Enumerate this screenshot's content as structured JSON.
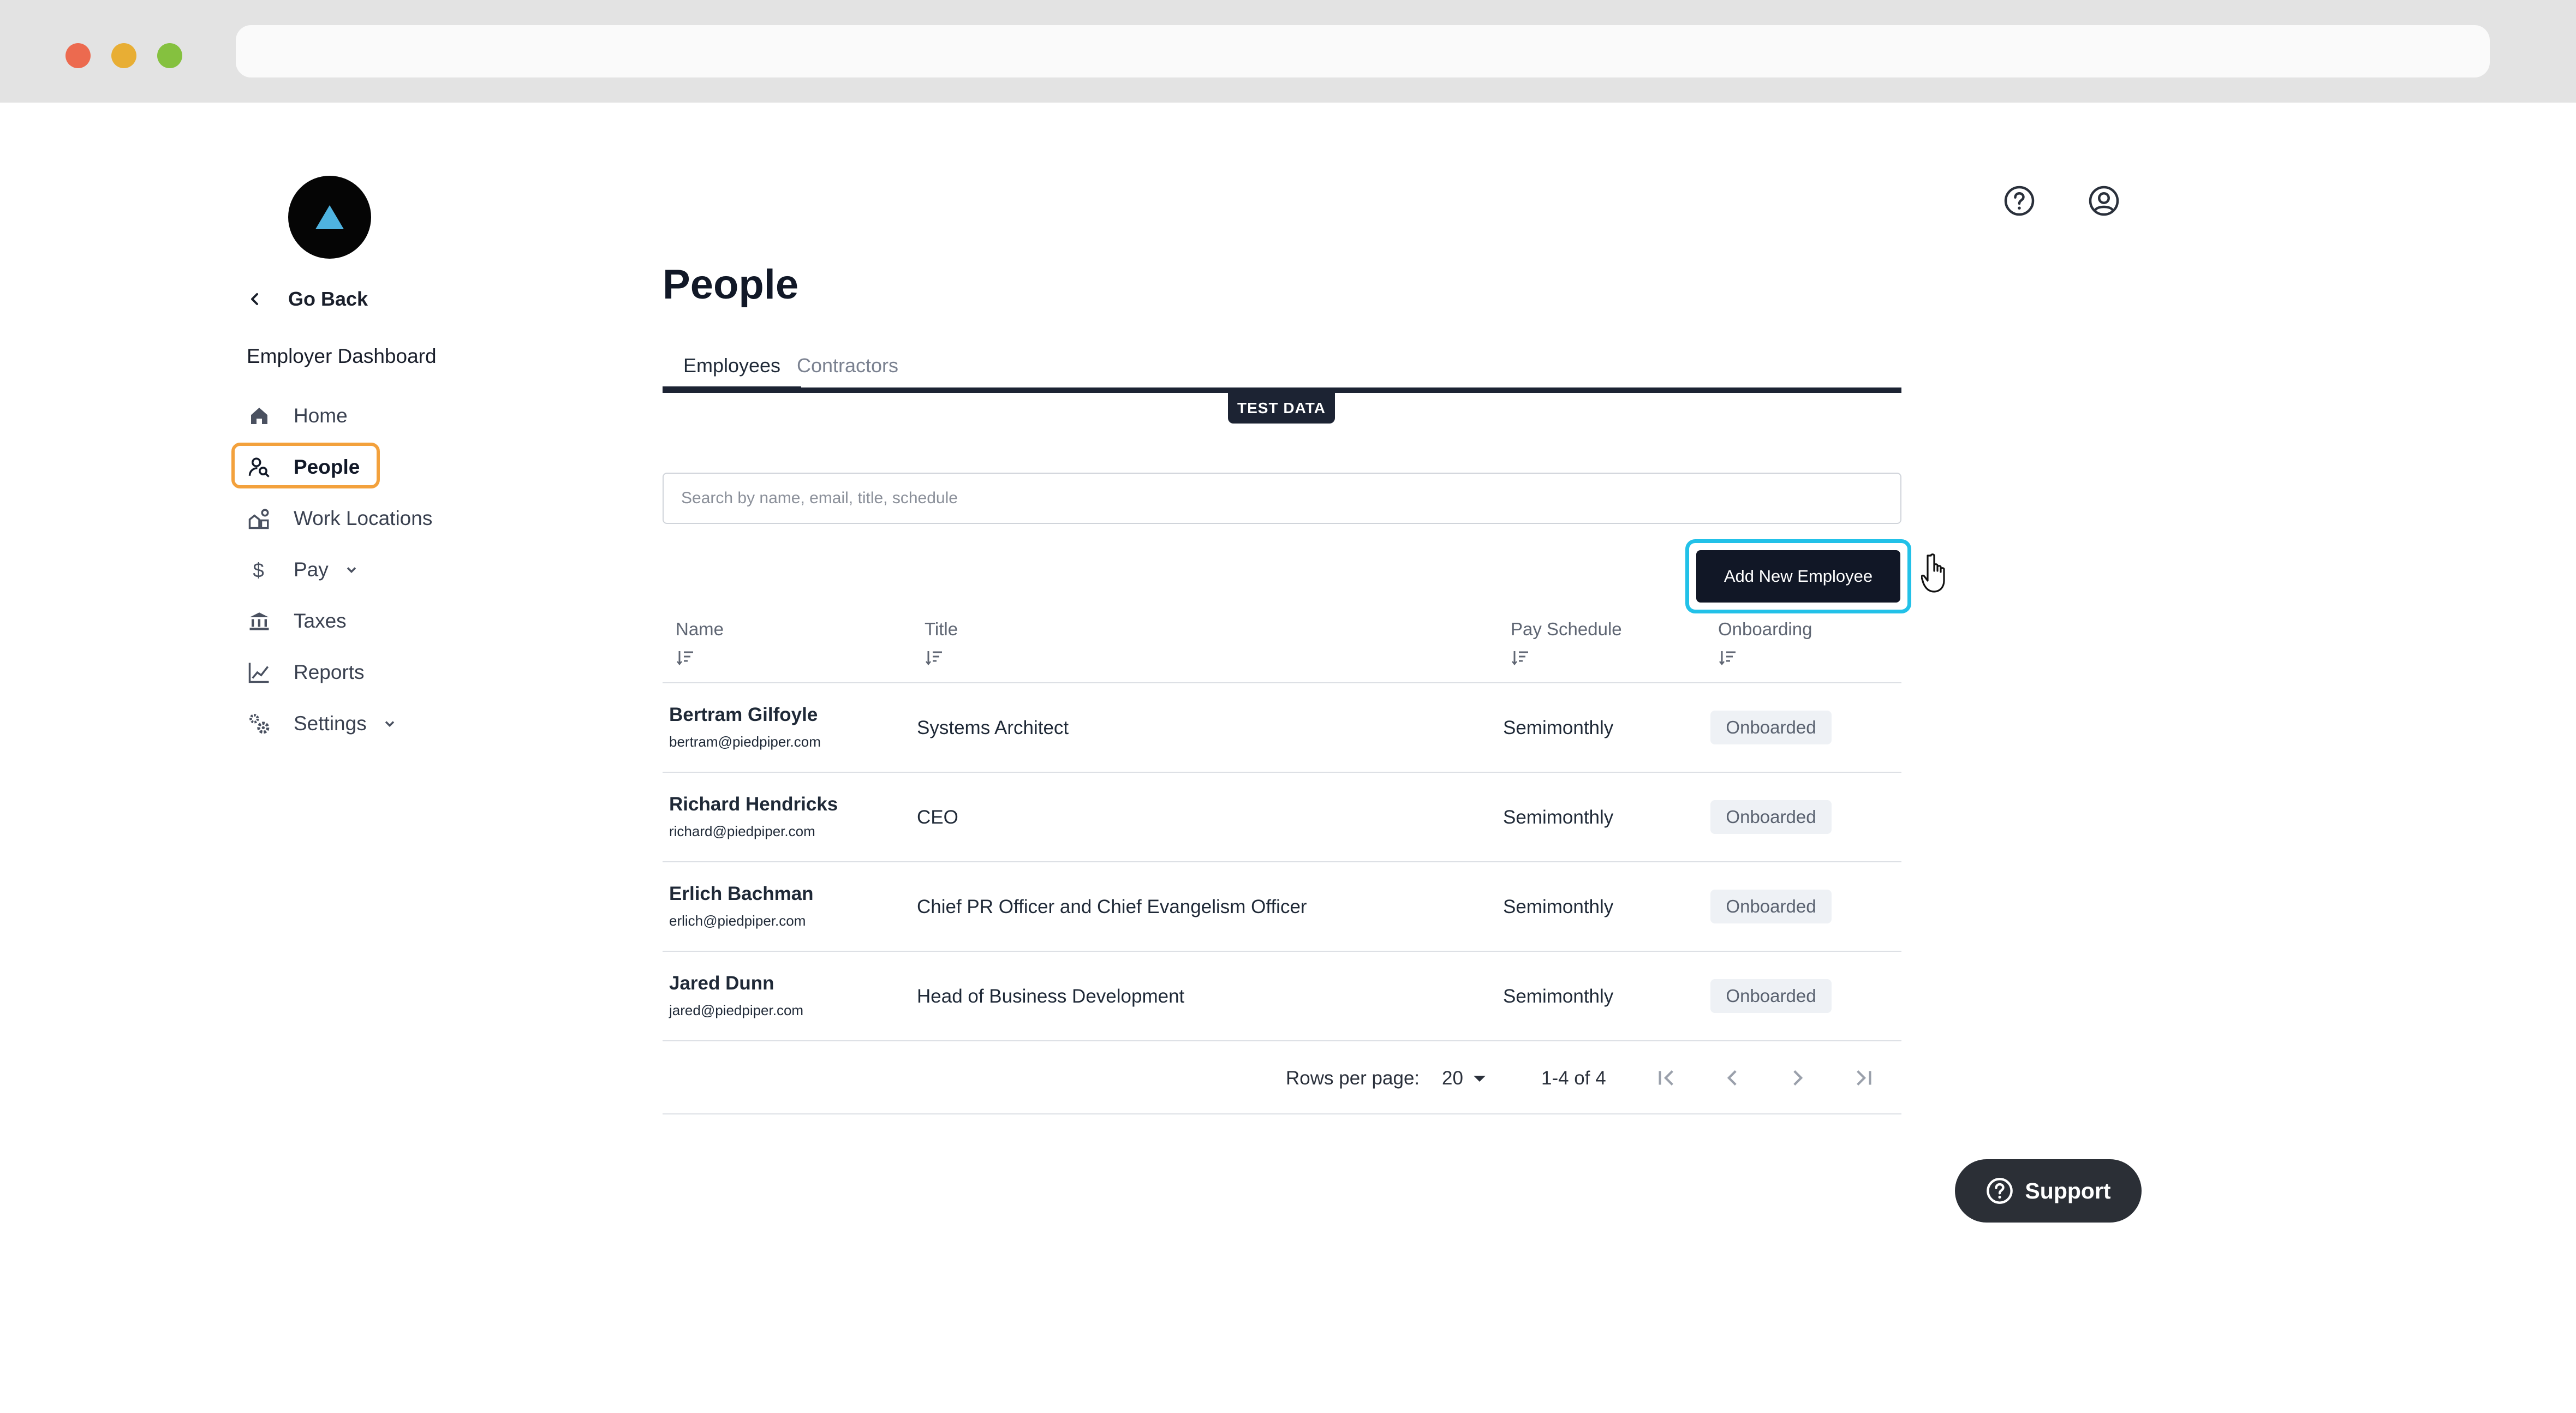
{
  "browser": {
    "url": ""
  },
  "sidebar": {
    "go_back": "Go Back",
    "section_title": "Employer Dashboard",
    "items": [
      {
        "label": "Home",
        "icon": "home-icon"
      },
      {
        "label": "People",
        "icon": "people-search-icon",
        "active": true
      },
      {
        "label": "Work Locations",
        "icon": "work-locations-icon"
      },
      {
        "label": "Pay",
        "icon": "dollar-icon",
        "expandable": true
      },
      {
        "label": "Taxes",
        "icon": "bank-icon"
      },
      {
        "label": "Reports",
        "icon": "chart-line-icon"
      },
      {
        "label": "Settings",
        "icon": "gears-icon",
        "expandable": true
      }
    ]
  },
  "header": {
    "help_icon": "help-circle-icon",
    "user_icon": "user-circle-icon"
  },
  "main": {
    "title": "People",
    "tabs": [
      {
        "label": "Employees",
        "active": true
      },
      {
        "label": "Contractors"
      }
    ],
    "test_badge": "TEST DATA",
    "search": {
      "placeholder": "Search by name, email, title, schedule",
      "value": ""
    },
    "add_button": "Add New Employee",
    "table": {
      "columns": [
        "Name",
        "Title",
        "Pay Schedule",
        "Onboarding"
      ],
      "rows": [
        {
          "name": "Bertram Gilfoyle",
          "email": "bertram@piedpiper.com",
          "title": "Systems Architect",
          "schedule": "Semimonthly",
          "status": "Onboarded"
        },
        {
          "name": "Richard Hendricks",
          "email": "richard@piedpiper.com",
          "title": "CEO",
          "schedule": "Semimonthly",
          "status": "Onboarded"
        },
        {
          "name": "Erlich Bachman",
          "email": "erlich@piedpiper.com",
          "title": "Chief PR Officer and Chief Evangelism Officer",
          "schedule": "Semimonthly",
          "status": "Onboarded"
        },
        {
          "name": "Jared Dunn",
          "email": "jared@piedpiper.com",
          "title": "Head of Business Development",
          "schedule": "Semimonthly",
          "status": "Onboarded"
        }
      ]
    },
    "pagination": {
      "rows_per_page_label": "Rows per page:",
      "rows_per_page": "20",
      "range": "1-4 of 4"
    }
  },
  "support": {
    "label": "Support"
  },
  "colors": {
    "accent_active": "#f3a13c",
    "highlight": "#22c1e8",
    "primary": "#111726",
    "logo_triangle": "#4fb3e0"
  }
}
